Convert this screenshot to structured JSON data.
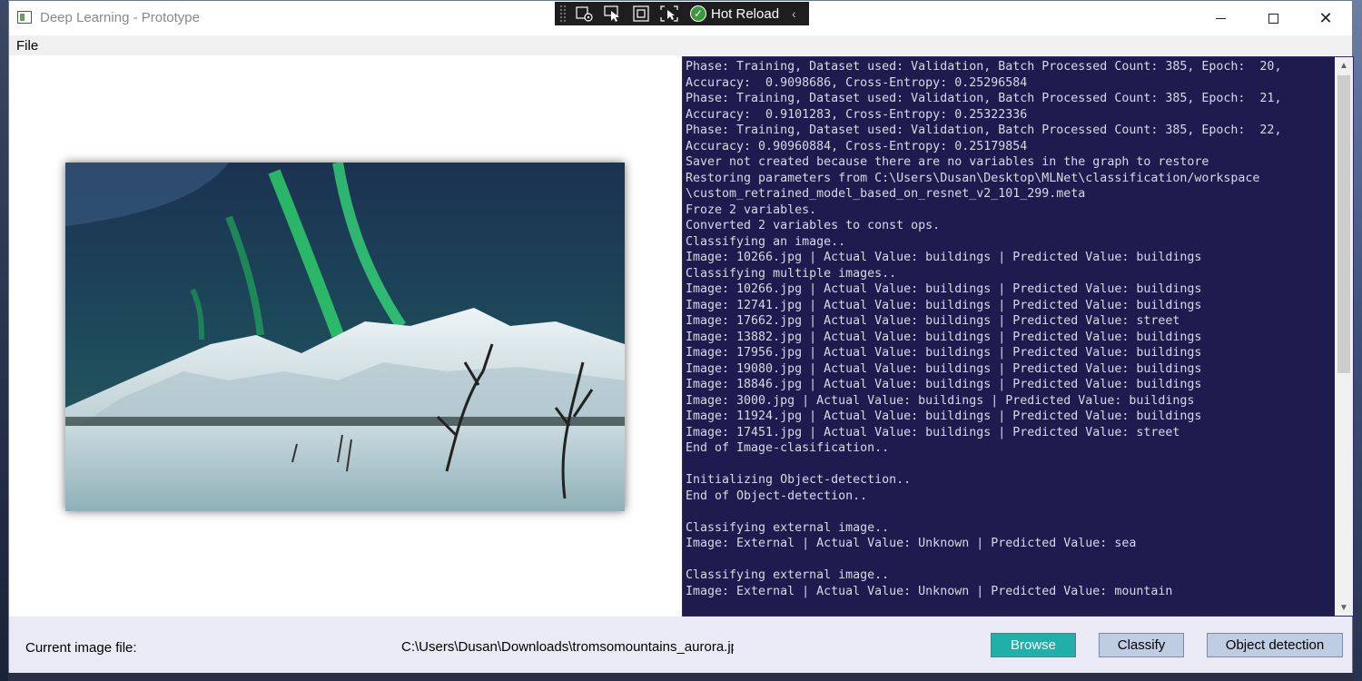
{
  "window": {
    "title": "Deep Learning - Prototype",
    "controls": {
      "minimize": "minimize",
      "maximize": "maximize",
      "close": "✕"
    }
  },
  "hot_reload": {
    "label": "Hot Reload",
    "collapse": "‹"
  },
  "menu": {
    "items": [
      "File"
    ]
  },
  "console": {
    "lines": [
      "Phase: Training, Dataset used: Validation, Batch Processed Count: 385, Epoch:  20,",
      "Accuracy:  0.9098686, Cross-Entropy: 0.25296584",
      "Phase: Training, Dataset used: Validation, Batch Processed Count: 385, Epoch:  21,",
      "Accuracy:  0.9101283, Cross-Entropy: 0.25322336",
      "Phase: Training, Dataset used: Validation, Batch Processed Count: 385, Epoch:  22,",
      "Accuracy: 0.90960884, Cross-Entropy: 0.25179854",
      "Saver not created because there are no variables in the graph to restore",
      "Restoring parameters from C:\\Users\\Dusan\\Desktop\\MLNet\\classification/workspace",
      "\\custom_retrained_model_based_on_resnet_v2_101_299.meta",
      "Froze 2 variables.",
      "Converted 2 variables to const ops.",
      "Classifying an image..",
      "Image: 10266.jpg | Actual Value: buildings | Predicted Value: buildings",
      "Classifying multiple images..",
      "Image: 10266.jpg | Actual Value: buildings | Predicted Value: buildings",
      "Image: 12741.jpg | Actual Value: buildings | Predicted Value: buildings",
      "Image: 17662.jpg | Actual Value: buildings | Predicted Value: street",
      "Image: 13882.jpg | Actual Value: buildings | Predicted Value: buildings",
      "Image: 17956.jpg | Actual Value: buildings | Predicted Value: buildings",
      "Image: 19080.jpg | Actual Value: buildings | Predicted Value: buildings",
      "Image: 18846.jpg | Actual Value: buildings | Predicted Value: buildings",
      "Image: 3000.jpg | Actual Value: buildings | Predicted Value: buildings",
      "Image: 11924.jpg | Actual Value: buildings | Predicted Value: buildings",
      "Image: 17451.jpg | Actual Value: buildings | Predicted Value: street",
      "End of Image-clasification..",
      "",
      "Initializing Object-detection..",
      "End of Object-detection..",
      "",
      "Classifying external image..",
      "Image: External | Actual Value: Unknown | Predicted Value: sea",
      "",
      "Classifying external image..",
      "Image: External | Actual Value: Unknown | Predicted Value: mountain"
    ],
    "colors": {
      "background": "#1e1b4e",
      "text": "#d9d9e3"
    }
  },
  "footer": {
    "current_label": "Current image file:",
    "path": "C:\\Users\\Dusan\\Downloads\\tromsomountains_aurora.jp",
    "buttons": {
      "browse": "Browse",
      "classify": "Classify",
      "object_detection": "Object detection"
    },
    "colors": {
      "browse": "#20b0a8",
      "secondary": "#bfcde3"
    }
  },
  "preview": {
    "icon": "aurora-landscape-image"
  }
}
